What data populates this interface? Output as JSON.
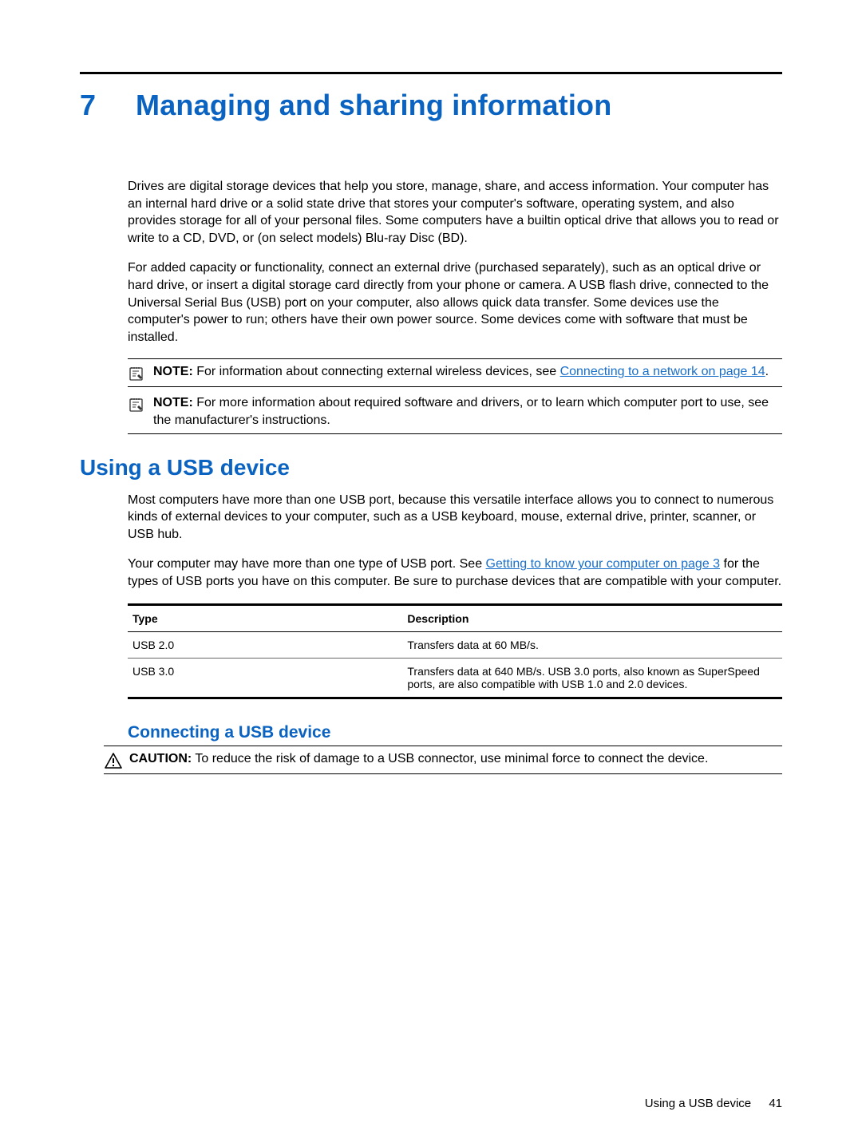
{
  "chapter": {
    "number": "7",
    "title": "Managing and sharing information"
  },
  "intro": {
    "p1": "Drives are digital storage devices that help you store, manage, share, and access information. Your computer has an internal hard drive or a solid state drive that stores your computer's software, operating system, and also provides storage for all of your personal files. Some computers have a builtin optical drive that allows you to read or write to a CD, DVD, or (on select models) Blu-ray Disc (BD).",
    "p2": "For added capacity or functionality, connect an external drive (purchased separately), such as an optical drive or hard drive, or insert a digital storage card directly from your phone or camera. A USB flash drive, connected to the Universal Serial Bus (USB) port on your computer, also allows quick data transfer. Some devices use the computer's power to run; others have their own power source. Some devices come with software that must be installed."
  },
  "note1": {
    "label": "NOTE:",
    "pre": "   For information about connecting external wireless devices, see ",
    "link": "Connecting to a network on page 14",
    "post": "."
  },
  "note2": {
    "label": "NOTE:",
    "text": "   For more information about required software and drivers, or to learn which computer port to use, see the manufacturer's instructions."
  },
  "section_usb": {
    "heading": "Using a USB device",
    "p1": "Most computers have more than one USB port, because this versatile interface allows you to connect to numerous kinds of external devices to your computer, such as a USB keyboard, mouse, external drive, printer, scanner, or USB hub.",
    "p2_pre": "Your computer may have more than one type of USB port. See ",
    "p2_link": "Getting to know your computer on page 3",
    "p2_post": " for the types of USB ports you have on this computer. Be sure to purchase devices that are compatible with your computer."
  },
  "usb_table": {
    "headers": {
      "type": "Type",
      "desc": "Description"
    },
    "rows": [
      {
        "type": "USB 2.0",
        "desc": "Transfers data at 60 MB/s."
      },
      {
        "type": "USB 3.0",
        "desc": "Transfers data at 640 MB/s. USB 3.0 ports, also known as SuperSpeed ports, are also compatible with USB 1.0 and 2.0 devices."
      }
    ]
  },
  "section_connecting": {
    "heading": "Connecting a USB device"
  },
  "caution": {
    "label": "CAUTION:",
    "text": "   To reduce the risk of damage to a USB connector, use minimal force to connect the device."
  },
  "footer": {
    "section": "Using a USB device",
    "page": "41"
  }
}
